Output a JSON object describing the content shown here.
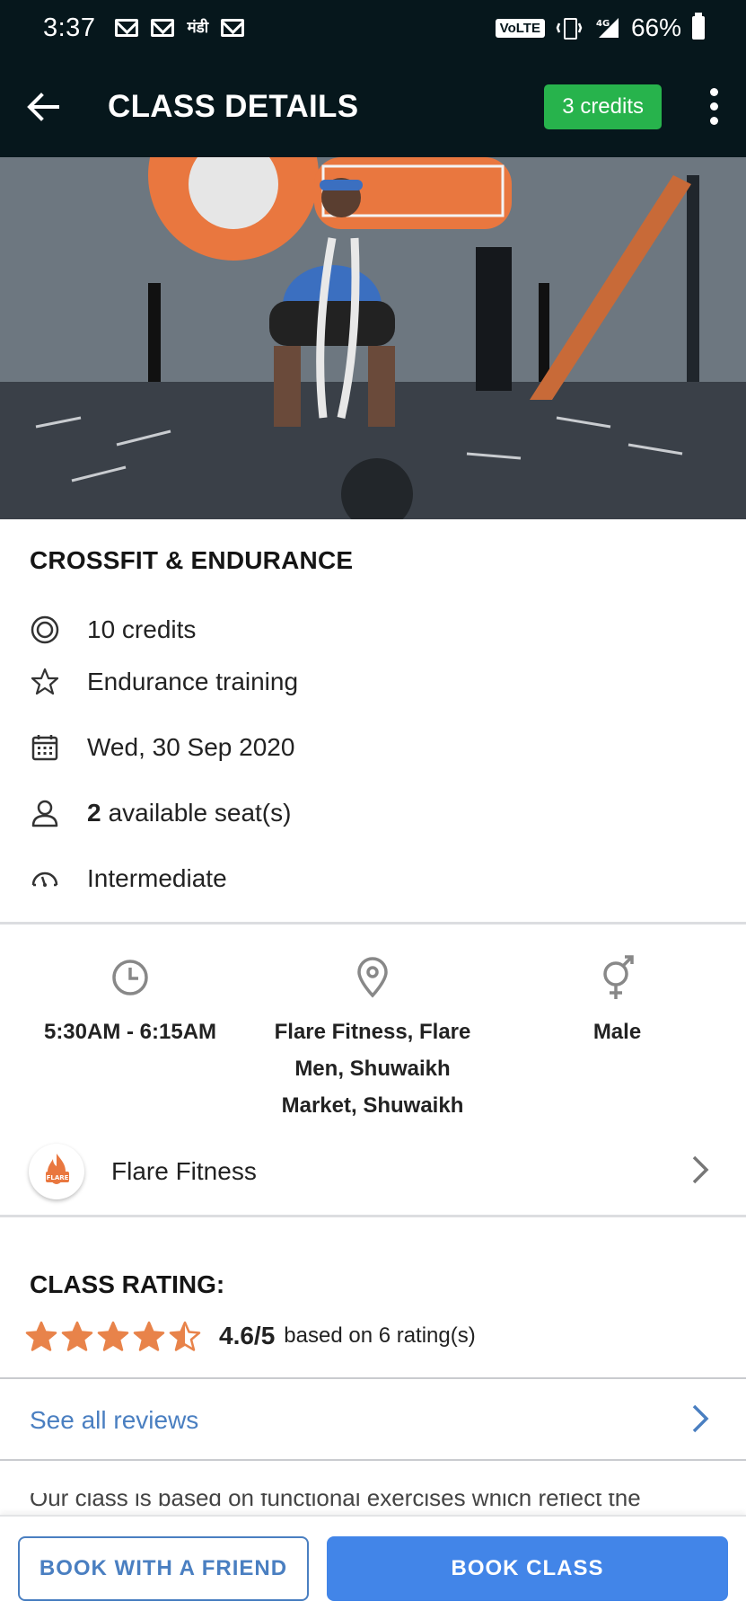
{
  "status_bar": {
    "time": "3:37",
    "hindi_app": "मंडी",
    "volte": "VoLTE",
    "battery_percent": "66%",
    "icons": [
      "mail-icon",
      "mail-icon",
      "mandi-app-icon",
      "mail-icon",
      "vibrate-icon",
      "signal-4g-icon",
      "battery-icon"
    ]
  },
  "header": {
    "title": "CLASS DETAILS",
    "credits_badge": "3 credits",
    "back_icon": "arrow-left-icon",
    "menu_icon": "more-vertical-icon"
  },
  "class": {
    "name": "CROSSFIT & ENDURANCE",
    "credits": "10 credits",
    "category": "Endurance training",
    "date": "Wed, 30 Sep 2020",
    "seats_count": "2",
    "seats_label": "available seat(s)",
    "level": "Intermediate"
  },
  "info": {
    "time": "5:30AM - 6:15AM",
    "location_lines": [
      "Flare Fitness, Flare",
      "Men, Shuwaikh",
      "Market, Shuwaikh"
    ],
    "gender": "Male"
  },
  "gym": {
    "name": "Flare Fitness",
    "logo_text": "FLARE"
  },
  "rating": {
    "heading": "CLASS RATING:",
    "value": "4.6/5",
    "caption": "based on 6 rating(s)",
    "stars": 4.6,
    "star_color": "#e8834a"
  },
  "reviews": {
    "link": "See all reviews"
  },
  "description": {
    "text": "Our class is based on functional exercises which reflect the"
  },
  "actions": {
    "book_friend": "BOOK WITH A FRIEND",
    "book_class": "BOOK CLASS"
  },
  "colors": {
    "header_bg": "#06171c",
    "badge_green": "#27b34c",
    "link_blue": "#4a7fc1",
    "button_blue": "#4285e8"
  }
}
